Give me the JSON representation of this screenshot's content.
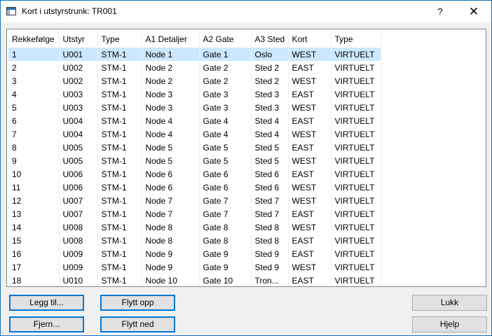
{
  "window": {
    "title": "Kort i utstyrstrunk: TR001",
    "help_label": "?",
    "close_label": "✕"
  },
  "table": {
    "columns": [
      "Rekkefølge",
      "Utstyr",
      "Type",
      "A1 Detaljer",
      "A2 Gate",
      "A3 Sted",
      "Kort",
      "Type"
    ],
    "rows": [
      [
        "1",
        "U001",
        "STM-1",
        "Node 1",
        "Gate 1",
        "Oslo",
        "WEST",
        "VIRTUELT"
      ],
      [
        "2",
        "U002",
        "STM-1",
        "Node 2",
        "Gate 2",
        "Sted 2",
        "EAST",
        "VIRTUELT"
      ],
      [
        "3",
        "U002",
        "STM-1",
        "Node 2",
        "Gate 2",
        "Sted 2",
        "WEST",
        "VIRTUELT"
      ],
      [
        "4",
        "U003",
        "STM-1",
        "Node 3",
        "Gate 3",
        "Sted 3",
        "EAST",
        "VIRTUELT"
      ],
      [
        "5",
        "U003",
        "STM-1",
        "Node 3",
        "Gate 3",
        "Sted 3",
        "WEST",
        "VIRTUELT"
      ],
      [
        "6",
        "U004",
        "STM-1",
        "Node 4",
        "Gate 4",
        "Sted 4",
        "EAST",
        "VIRTUELT"
      ],
      [
        "7",
        "U004",
        "STM-1",
        "Node 4",
        "Gate 4",
        "Sted 4",
        "WEST",
        "VIRTUELT"
      ],
      [
        "8",
        "U005",
        "STM-1",
        "Node 5",
        "Gate 5",
        "Sted 5",
        "EAST",
        "VIRTUELT"
      ],
      [
        "9",
        "U005",
        "STM-1",
        "Node 5",
        "Gate 5",
        "Sted 5",
        "WEST",
        "VIRTUELT"
      ],
      [
        "10",
        "U006",
        "STM-1",
        "Node 6",
        "Gate 6",
        "Sted 6",
        "EAST",
        "VIRTUELT"
      ],
      [
        "11",
        "U006",
        "STM-1",
        "Node 6",
        "Gate 6",
        "Sted 6",
        "WEST",
        "VIRTUELT"
      ],
      [
        "12",
        "U007",
        "STM-1",
        "Node 7",
        "Gate 7",
        "Sted 7",
        "WEST",
        "VIRTUELT"
      ],
      [
        "13",
        "U007",
        "STM-1",
        "Node 7",
        "Gate 7",
        "Sted 7",
        "EAST",
        "VIRTUELT"
      ],
      [
        "14",
        "U008",
        "STM-1",
        "Node 8",
        "Gate 8",
        "Sted 8",
        "WEST",
        "VIRTUELT"
      ],
      [
        "15",
        "U008",
        "STM-1",
        "Node 8",
        "Gate 8",
        "Sted 8",
        "EAST",
        "VIRTUELT"
      ],
      [
        "16",
        "U009",
        "STM-1",
        "Node 9",
        "Gate 9",
        "Sted 9",
        "EAST",
        "VIRTUELT"
      ],
      [
        "17",
        "U009",
        "STM-1",
        "Node 9",
        "Gate 9",
        "Sted 9",
        "WEST",
        "VIRTUELT"
      ],
      [
        "18",
        "U010",
        "STM-1",
        "Node 10",
        "Gate 10",
        "Tron...",
        "EAST",
        "VIRTUELT"
      ]
    ]
  },
  "buttons": {
    "add": "Legg til...",
    "remove": "Fjern...",
    "move_up": "Flytt opp",
    "move_down": "Flytt ned",
    "close": "Lukk",
    "help": "Hjelp"
  }
}
